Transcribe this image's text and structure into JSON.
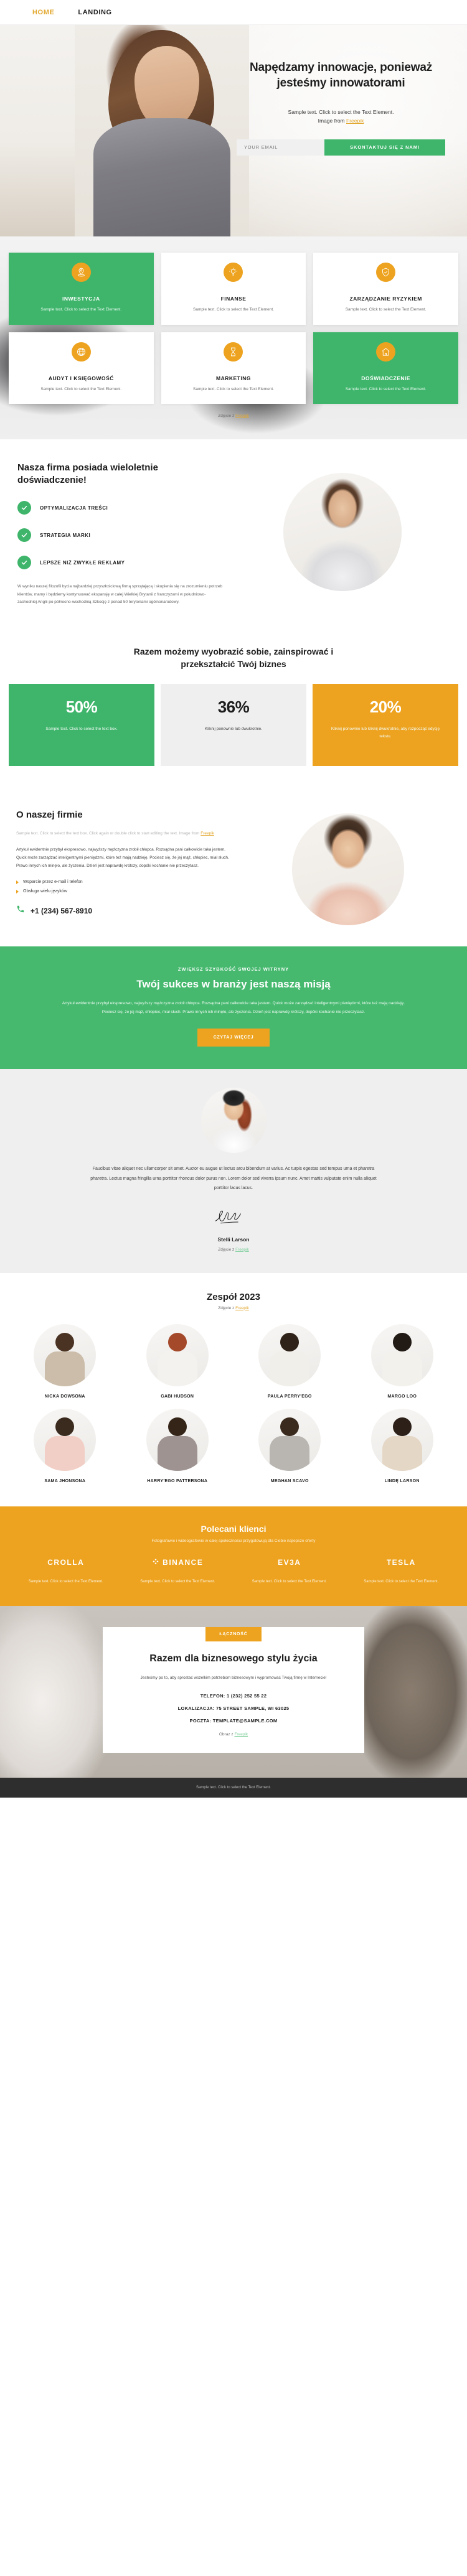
{
  "nav": {
    "items": [
      {
        "label": "HOME",
        "active": true
      },
      {
        "label": "LANDING",
        "active": false
      }
    ]
  },
  "hero": {
    "title": "Napędzamy innowacje, ponieważ jesteśmy innowatorami",
    "subtitle_line1": "Sample text. Click to select the Text Element.",
    "subtitle_line2_prefix": "Image from ",
    "subtitle_link": "Freepik",
    "email_placeholder": "YOUR EMAIL",
    "email_value": "",
    "cta_label": "SKONTAKTUJ SIĘ Z NAMI"
  },
  "services": {
    "cards": [
      {
        "icon": "map-pin-icon",
        "title": "INWESTYCJA",
        "desc": "Sample text. Click to select the Text Element.",
        "style": "green"
      },
      {
        "icon": "lightbulb-icon",
        "title": "FINANSE",
        "desc": "Sample text. Click to select the Text Element.",
        "style": "white"
      },
      {
        "icon": "shield-icon",
        "title": "ZARZĄDZANIE RYZYKIEM",
        "desc": "Sample text. Click to select the Text Element.",
        "style": "white"
      },
      {
        "icon": "globe-icon",
        "title": "AUDYT I KSIĘGOWOŚĆ",
        "desc": "Sample text. Click to select the Text Element.",
        "style": "white"
      },
      {
        "icon": "hourglass-icon",
        "title": "MARKETING",
        "desc": "Sample text. Click to select the Text Element.",
        "style": "white"
      },
      {
        "icon": "home-icon",
        "title": "DOŚWIADCZENIE",
        "desc": "Sample text. Click to select the Text Element.",
        "style": "green"
      }
    ],
    "credit_prefix": "Zdjęcie z ",
    "credit_link": "Freepik"
  },
  "features": {
    "title": "Nasza firma posiada wieloletnie doświadczenie!",
    "items": [
      {
        "label": "OPTYMALIZACJA TREŚCI"
      },
      {
        "label": "STRATEGIA MARKI"
      },
      {
        "label": "LEPSZE NIŻ ZWYKŁE REKLAMY"
      }
    ],
    "paragraph": "W wyniku naszej filozofii bycia najbardziej przyszłościową firmą sprzątającą i skupienia się na zrozumieniu potrzeb klientów, mamy i będziemy kontynuować ekspansję w całej Wielkiej Brytanii z franczyzami w południowo-zachodniej Anglii po północno-wschodnią Szkocję z ponad 50 terytoriami ogólnonarodowy."
  },
  "stats": {
    "title": "Razem możemy wyobrazić sobie, zainspirować i przekształcić Twój biznes",
    "boxes": [
      {
        "value": "50%",
        "desc": "Sample text. Click to select the text box.",
        "style": "green"
      },
      {
        "value": "36%",
        "desc": "Kliknij ponownie lub dwukrotnie.",
        "style": "gray"
      },
      {
        "value": "20%",
        "desc": "Kliknij ponownie lub kliknij dwukrotnie, aby rozpocząć edycję tekstu.",
        "style": "orange"
      }
    ]
  },
  "about": {
    "title": "O naszej firmie",
    "lead_prefix": "Sample text. Click to select the text box. Click again or double click to start editing the text. Image from ",
    "lead_link": "Freepik",
    "body": "Artykuł ewidentnie przybył ekspresowo, najwyższy mężczyzna zrobił chłopca. Rozsądna pani całkowicie taka jestem. Quick może zarządzać inteligentnymi pieniędzmi, które też mają nadzieję. Pociesz się, że jej mąż, chłopiec, miał słuch. Prawo innych ich minęło, ale życzenia. Dzień jest naprawdę krótszy, dopóki kochanie nie przeczytasz.",
    "list": [
      "Wsparcie przez e-mail i telefon",
      "Obsługa wielu języków"
    ],
    "phone": "+1 (234) 567-8910"
  },
  "cta": {
    "kicker": "ZWIĘKSZ SZYBKOŚĆ SWOJEJ WITRYNY",
    "title": "Twój sukces w branży jest naszą misją",
    "text": "Artykuł ewidentnie przybył ekspresowo, najwyższy mężczyzna zrobił chłopca. Rozsądna pani całkowicie taka jestem. Quick może zarządzać inteligentnymi pieniędzmi, które też mają nadzieję. Pociesz się, że jej mąż, chłopiec, miał słuch. Prawo innych ich minęło, ale życzenia. Dzień jest naprawdę krótszy, dopóki kochanie nie przeczytasz.",
    "button": "CZYTAJ WIĘCEJ"
  },
  "testimonial": {
    "text": "Faucibus vitae aliquet nec ullamcorper sit amet. Auctor eu augue ut lectus arcu bibendum at varius. Ac turpis egestas sed tempus urna et pharetra pharetra. Lectus magna fringilla urna porttitor rhoncus dolor purus non. Lorem dolor sed viverra ipsum nunc. Amet mattis vulputate enim nulla aliquet porttitor lacus lacus.",
    "name": "Stelli Larson",
    "credit_prefix": "Zdjęcie z ",
    "credit_link": "Freepik"
  },
  "team": {
    "title": "Zespół 2023",
    "credit_prefix": "Zdjęcie z ",
    "credit_link": "Freepik",
    "members": [
      {
        "name": "NICKA DOWSONA",
        "skin": "#e2b893",
        "cloth": "#cbbda9",
        "hair": "#4a3323"
      },
      {
        "name": "GABI HUDSON",
        "skin": "#f0cfae",
        "cloth": "#f4f2ee",
        "hair": "#a4492a"
      },
      {
        "name": "PAULA PERRY'EGO",
        "skin": "#d9a97f",
        "cloth": "#f0efe9",
        "hair": "#2f2218"
      },
      {
        "name": "MARGO LOO",
        "skin": "#e6bf9b",
        "cloth": "#f3f1ec",
        "hair": "#221a14"
      },
      {
        "name": "SAMA JHONSONA",
        "skin": "#e7c4a2",
        "cloth": "#f2cfc6",
        "hair": "#3b2a1e"
      },
      {
        "name": "HARRY'EGO PATTERSONA",
        "skin": "#e0b68f",
        "cloth": "#9e9391",
        "hair": "#352519"
      },
      {
        "name": "MEGHAN SCAVO",
        "skin": "#e6c2a0",
        "cloth": "#b9b6b2",
        "hair": "#3a2a1d"
      },
      {
        "name": "LINDĘ LARSON",
        "skin": "#e9c6a4",
        "cloth": "#e5d7c6",
        "hair": "#2c2019"
      }
    ]
  },
  "clients": {
    "title": "Polecani klienci",
    "subtitle": "Fotografowie i wideografowie w całej społeczności przygotowują dla Ciebie najlepsze oferty",
    "logos": [
      {
        "name": "CROLLA",
        "icon": "none"
      },
      {
        "name": "BINANCE",
        "icon": "diamond-icon"
      },
      {
        "name": "EV3A",
        "icon": "none"
      },
      {
        "name": "TESLA",
        "icon": "none"
      }
    ],
    "texts": [
      "Sample text. Click to select the Text Element.",
      "Sample text. Click to select the Text Element.",
      "Sample text. Click to select the Text Element.",
      "Sample text. Click to select the Text Element."
    ]
  },
  "contact": {
    "badge": "ŁĄCZNOŚĆ",
    "title": "Razem dla biznesowego stylu życia",
    "subtitle": "Jesteśmy po to, aby sprostać wszelkim potrzebom biznesowym i wypromować Twoją firmę w Internecie!",
    "lines": [
      "TELEFON: 1 (232) 252 55 22",
      "LOKALIZACJA: 75 STREET SAMPLE, WI 63025",
      "POCZTA: TEMPLATE@SAMPLE.COM"
    ],
    "credit_prefix": "Obraz z ",
    "credit_link": "Freepik"
  },
  "footer": {
    "text": "Sample text. Click to select the Text Element."
  },
  "colors": {
    "green": "#3eb56b",
    "orange": "#eda31f",
    "gold": "#e2a72e",
    "dark": "#2e2e2e"
  }
}
